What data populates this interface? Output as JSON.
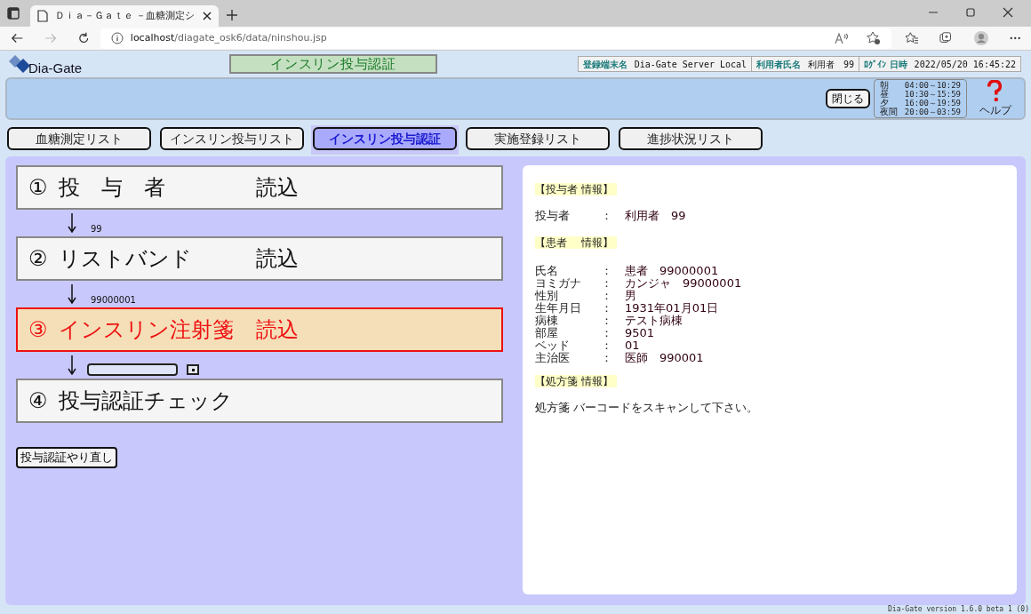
{
  "browser": {
    "tab_title": "Ｄｉａ－Ｇａｔｅ －血糖測定シ",
    "url_host": "localhost",
    "url_path": "/diagate_osk6/data/ninshou.jsp"
  },
  "header": {
    "logo": "Dia-Gate",
    "page_title": "インスリン投与認証",
    "info": [
      {
        "label": "登録端末名",
        "value": "Dia-Gate Server Local"
      },
      {
        "label": "利用者氏名",
        "value": "利用者　99"
      },
      {
        "label": "ﾛｸﾞｲﾝ 日時",
        "value": "2022/05/20 16:45:22"
      }
    ]
  },
  "toolbar": {
    "close_button": "閉じる",
    "shifts": [
      {
        "name": "朝",
        "time": "04:00～10:29"
      },
      {
        "name": "昼",
        "time": "10:30～15:59"
      },
      {
        "name": "夕",
        "time": "16:00～19:59"
      },
      {
        "name": "夜間",
        "time": "20:00～03:59"
      }
    ],
    "help_label": "ヘルプ"
  },
  "tabs": [
    {
      "label": "血糖測定リスト",
      "selected": false
    },
    {
      "label": "インスリン投与リスト",
      "selected": false
    },
    {
      "label": "インスリン投与認証",
      "selected": true
    },
    {
      "label": "実施登録リスト",
      "selected": false
    },
    {
      "label": "進捗状況リスト",
      "selected": false
    }
  ],
  "steps": [
    {
      "number": "①",
      "title": "投　与　者",
      "action": "読込",
      "active": false,
      "result": "99"
    },
    {
      "number": "②",
      "title": "リストバンド",
      "action": "読込",
      "active": false,
      "result": "99000001"
    },
    {
      "number": "③",
      "title": "インスリン注射箋",
      "action": "読込",
      "active": true,
      "input": true
    },
    {
      "number": "④",
      "title": "投与認証チェック",
      "active": false
    }
  ],
  "reset_button": "投与認証やり直し",
  "info_sections": [
    {
      "heading": "【投与者 情報】",
      "rows": [
        {
          "label": "投与者",
          "value": "利用者　99"
        }
      ]
    },
    {
      "heading": "【患者　 情報】",
      "rows": [
        {
          "label": "氏名",
          "value": "患者　99000001"
        },
        {
          "label": "ヨミガナ",
          "value": "カンジャ　99000001"
        },
        {
          "label": "性別",
          "value": "男"
        },
        {
          "label": "生年月日",
          "value": "1931年01月01日"
        },
        {
          "label": "病棟",
          "value": "テスト病棟"
        },
        {
          "label": "部屋",
          "value": "9501"
        },
        {
          "label": "ベッド",
          "value": "01"
        },
        {
          "label": "主治医",
          "value": "医師　990001"
        }
      ]
    },
    {
      "heading": "【処方箋 情報】",
      "message": "処方箋 バーコードをスキャンして下さい。"
    }
  ],
  "separator": "：",
  "footer": "Dia-Gate version 1.6.0 beta 1 (0)"
}
